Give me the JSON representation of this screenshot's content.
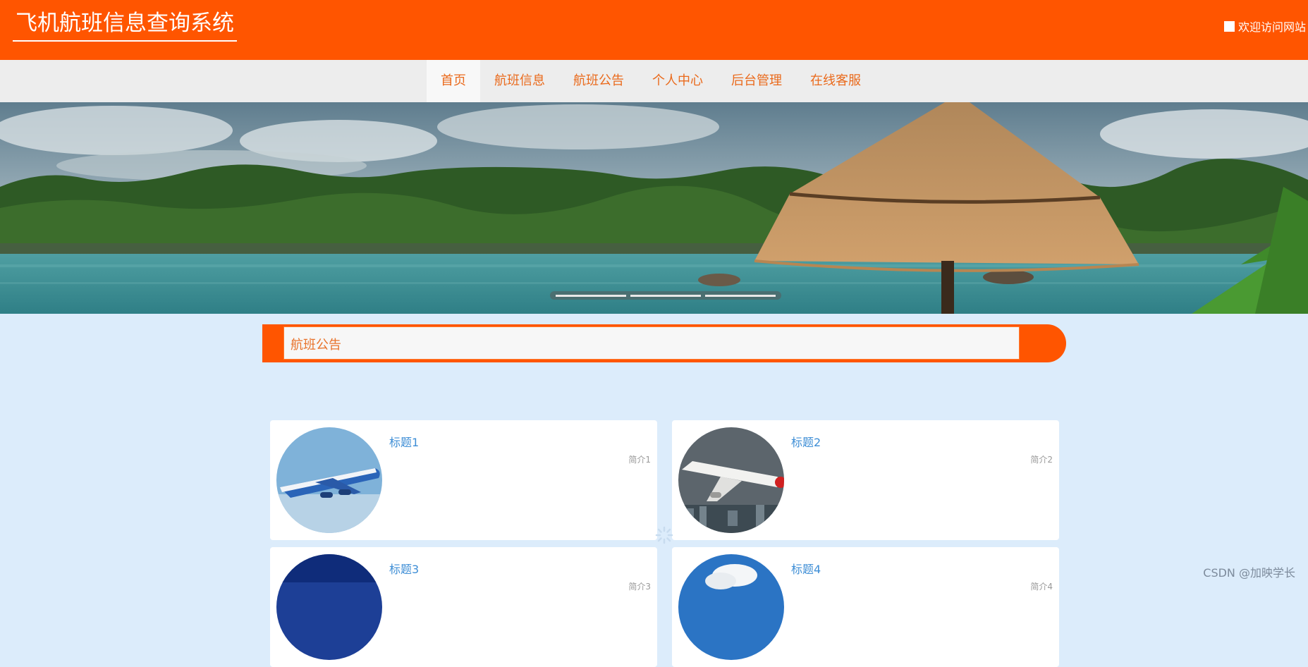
{
  "header": {
    "site_title": "飞机航班信息查询系统",
    "welcome_text": "欢迎访问网站",
    "bg_color": "#ff5500"
  },
  "nav": {
    "items": [
      {
        "label": "首页",
        "active": true
      },
      {
        "label": "航班信息"
      },
      {
        "label": "航班公告"
      },
      {
        "label": "个人中心"
      },
      {
        "label": "后台管理"
      },
      {
        "label": "在线客服"
      }
    ],
    "accent_color": "#ea6a1c"
  },
  "banner": {
    "slide_count": 3,
    "active_slide": 1
  },
  "notice": {
    "label": "航班公告"
  },
  "cards": [
    {
      "title": "标题1",
      "desc": "简介1"
    },
    {
      "title": "标题2",
      "desc": "简介2"
    },
    {
      "title": "标题3",
      "desc": "简介3"
    },
    {
      "title": "标题4",
      "desc": "简介4"
    }
  ],
  "watermark": "CSDN @加映学长",
  "icons": {
    "welcome": "square-icon",
    "cursor": "mouse-pointer-icon",
    "loading": "loading-spinner-icon"
  }
}
